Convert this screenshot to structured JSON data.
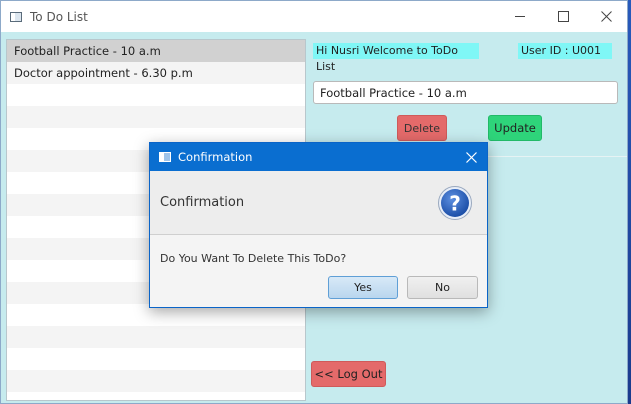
{
  "window": {
    "title": "To Do List",
    "icon": "app-window-icon",
    "controls": [
      "minimize-icon",
      "maximize-icon",
      "close-icon"
    ]
  },
  "todo_list": {
    "items": [
      {
        "label": "Football Practice - 10 a.m",
        "selected": true
      },
      {
        "label": "Doctor appointment - 6.30 p.m",
        "selected": false
      }
    ]
  },
  "header": {
    "welcome": "Hi Nusri Welcome to ToDo List",
    "user_id": "User ID : U001"
  },
  "editor": {
    "input_value": "Football Practice - 10 a.m",
    "delete_label": "Delete",
    "update_label": "Update"
  },
  "logout_label": "<< Log Out",
  "dialog": {
    "title": "Confirmation",
    "header": "Confirmation",
    "message": "Do You Want To Delete This ToDo?",
    "yes_label": "Yes",
    "no_label": "No",
    "icon": "question-icon"
  },
  "colors": {
    "window_bg": "#c6ebee",
    "label_bg": "#7ff7f6",
    "delete_bg": "#e46a6a",
    "update_bg": "#2ed47a",
    "dialog_title_bg": "#0a6ed0"
  }
}
